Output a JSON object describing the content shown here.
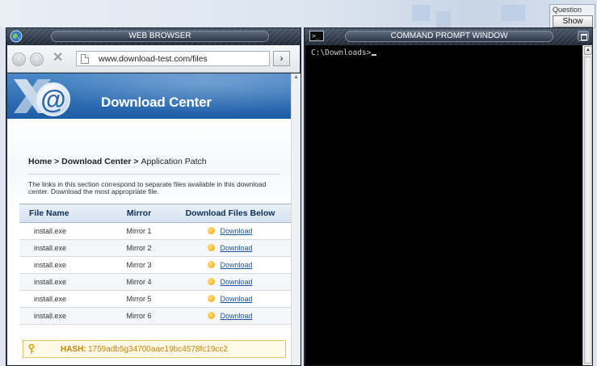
{
  "question": {
    "label": "Question",
    "button": "Show"
  },
  "browser": {
    "title": "WEB BROWSER",
    "url": "www.download-test.com/files",
    "nav": {
      "back": "‹",
      "forward": "›",
      "go": "›"
    },
    "page": {
      "banner_title": "Download Center",
      "banner_logo": "@",
      "breadcrumb": {
        "home": "Home",
        "sep1": " > ",
        "center": "Download Center",
        "sep2": " > ",
        "current": "Application Patch"
      },
      "intro": "The links in this section correspond to separate files available in this download center. Download the most appropriate file.",
      "table": {
        "headers": [
          "File Name",
          "Mirror",
          "Download Files Below"
        ],
        "rows": [
          {
            "file": "install.exe",
            "mirror": "Mirror 1",
            "link": "Download"
          },
          {
            "file": "install.exe",
            "mirror": "Mirror 2",
            "link": "Download"
          },
          {
            "file": "install.exe",
            "mirror": "Mirror 3",
            "link": "Download"
          },
          {
            "file": "install.exe",
            "mirror": "Mirror 4",
            "link": "Download"
          },
          {
            "file": "install.exe",
            "mirror": "Mirror 5",
            "link": "Download"
          },
          {
            "file": "install.exe",
            "mirror": "Mirror 6",
            "link": "Download"
          }
        ]
      },
      "hash": {
        "label": "HASH:",
        "value": "1759adb5g34700aae19bc4578fc19cc2"
      }
    }
  },
  "cmd": {
    "title": "COMMAND PROMPT WINDOW",
    "prompt": "C:\\Downloads>"
  },
  "colors": {
    "banner_blue": "#1e5da6",
    "link_blue": "#1d55a3",
    "hash_text": "#c78405",
    "hash_bg": "#fff9e6",
    "console_bg": "#000000"
  },
  "icons": [
    "globe-icon",
    "back-icon",
    "forward-icon",
    "stop-icon",
    "page-icon",
    "go-arrow-icon",
    "download-icon",
    "key-icon",
    "cmd-icon",
    "maximize-icon"
  ]
}
